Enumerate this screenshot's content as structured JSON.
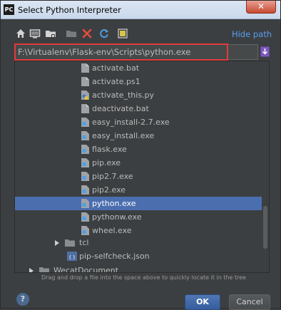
{
  "window": {
    "title": "Select Python Interpreter",
    "app_icon_text": "PC",
    "close_glyph": "✕"
  },
  "toolbar": {
    "icons": [
      "home-icon",
      "desktop-icon",
      "project-folder-icon",
      "new-folder-icon",
      "delete-icon",
      "refresh-icon",
      "show-hidden-icon"
    ],
    "hide_path_label": "Hide path"
  },
  "path": {
    "value": "F:\\Virtualenv\\Flask-env\\Scripts\\python.exe"
  },
  "tree": {
    "scripts_files": [
      {
        "label": "activate.bat",
        "icon": "file-icon"
      },
      {
        "label": "activate.ps1",
        "icon": "file-icon"
      },
      {
        "label": "activate_this.py",
        "icon": "python-file-icon"
      },
      {
        "label": "deactivate.bat",
        "icon": "file-icon"
      },
      {
        "label": "easy_install-2.7.exe",
        "icon": "exe-file-icon"
      },
      {
        "label": "easy_install.exe",
        "icon": "exe-file-icon"
      },
      {
        "label": "flask.exe",
        "icon": "exe-file-icon"
      },
      {
        "label": "pip.exe",
        "icon": "exe-file-icon"
      },
      {
        "label": "pip2.7.exe",
        "icon": "exe-file-icon"
      },
      {
        "label": "pip2.exe",
        "icon": "exe-file-icon"
      },
      {
        "label": "python.exe",
        "icon": "exe-file-icon",
        "selected": true
      },
      {
        "label": "pythonw.exe",
        "icon": "exe-file-icon"
      },
      {
        "label": "wheel.exe",
        "icon": "exe-file-icon"
      }
    ],
    "tcl_folder": "tcl",
    "pip_selfcheck": "pip-selfcheck.json",
    "wecat_folder": "WecatDocument"
  },
  "hint": "Drag and drop a file into the space above to quickly locate it in the tree",
  "buttons": {
    "help": "?",
    "ok": "OK",
    "cancel": "Cancel"
  },
  "colors": {
    "background": "#3c3f41",
    "selection": "#4b6eaf",
    "link": "#589df6",
    "highlight_border": "#e03a3a"
  }
}
